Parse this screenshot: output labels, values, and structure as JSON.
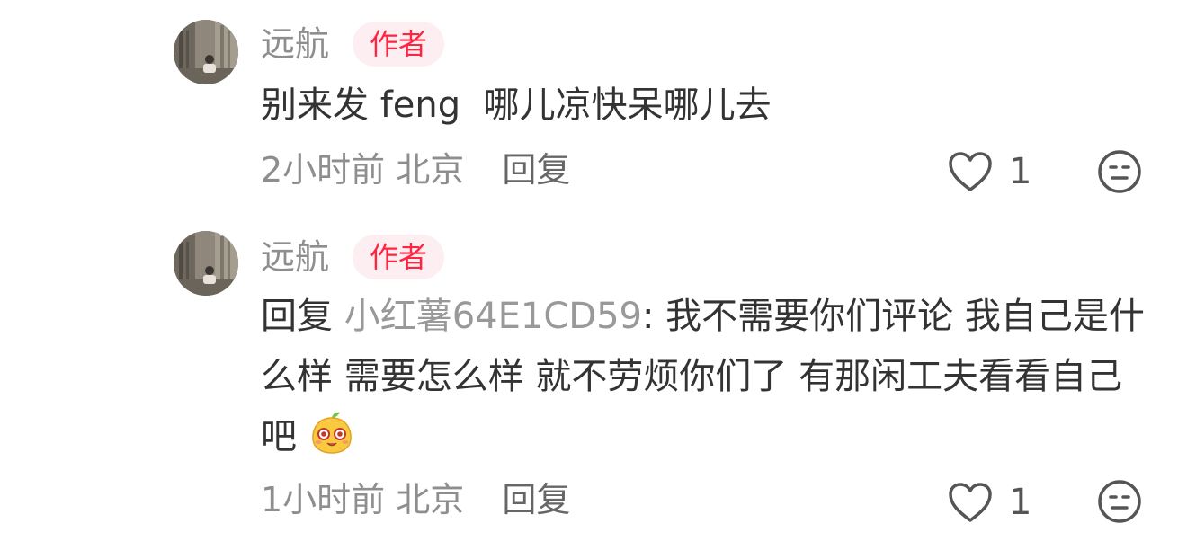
{
  "comments": [
    {
      "author": "远航",
      "badge": "作者",
      "text": "别来发 feng  哪儿凉快呆哪儿去",
      "time": "2小时前",
      "location": "北京",
      "reply_label": "回复",
      "likes": "1"
    },
    {
      "author": "远航",
      "badge": "作者",
      "reply_prefix": "回复",
      "mention": "小红薯64E1CD59",
      "text": ": 我不需要你们评论  我自己是什么样 需要怎么样  就不劳烦你们了 有那闲工夫看看自己吧",
      "time": "1小时前",
      "location": "北京",
      "reply_label": "回复",
      "likes": "1"
    }
  ],
  "icons": {
    "like": "heart-outline-icon",
    "dislike": "neutral-face-icon",
    "emoji": "mango-face-emoji"
  },
  "colors": {
    "badge_text": "#ff2442",
    "badge_bg": "#fdeff1",
    "meta": "#8e8e8e",
    "text": "#333333"
  }
}
